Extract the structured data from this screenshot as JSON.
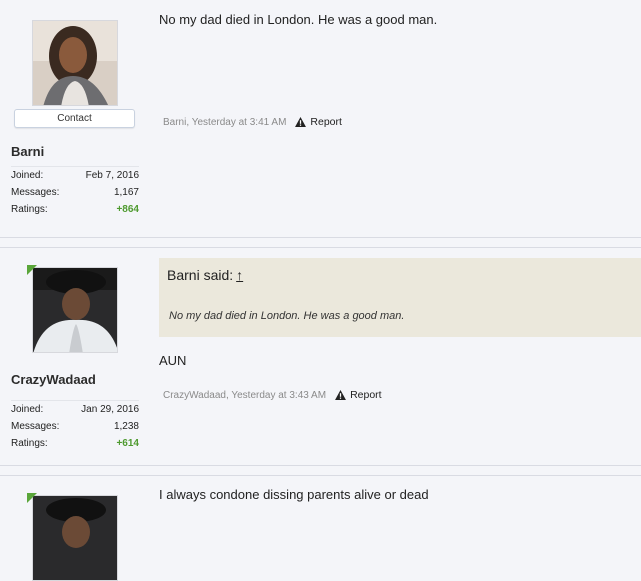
{
  "posts": [
    {
      "username": "Barni",
      "contact_label": "Contact",
      "stats": [
        {
          "label": "Joined:",
          "value": "Feb 7, 2016"
        },
        {
          "label": "Messages:",
          "value": "1,167"
        },
        {
          "label": "Ratings:",
          "value": "+864"
        }
      ],
      "message": "No my dad died in London. He was a good man.",
      "meta": "Barni, Yesterday at 3:41 AM",
      "report_label": "Report"
    },
    {
      "username": "CrazyWadaad",
      "stats": [
        {
          "label": "Joined:",
          "value": "Jan 29, 2016"
        },
        {
          "label": "Messages:",
          "value": "1,238"
        },
        {
          "label": "Ratings:",
          "value": "+614"
        }
      ],
      "quote": {
        "author_said": "Barni said:",
        "arrow": "↑",
        "text": "No my dad died in London. He was a good man."
      },
      "message": "AUN",
      "meta": "CrazyWadaad, Yesterday at 3:43 AM",
      "report_label": "Report"
    },
    {
      "message": "I always condone dissing parents alive or dead"
    }
  ],
  "colors": {
    "rating": "#4e9a2f",
    "quote_bg": "#ebe8dc",
    "page_bg": "#f4f5f9",
    "online_ribbon": "#5aa63a"
  }
}
